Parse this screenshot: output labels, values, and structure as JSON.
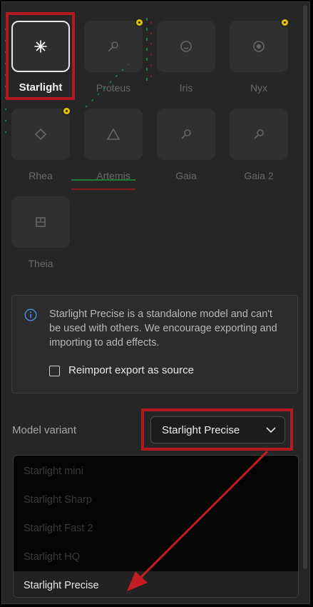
{
  "models": [
    {
      "label": "Starlight",
      "icon": "sparkle-icon",
      "selected": true,
      "badge": false
    },
    {
      "label": "Proteus",
      "icon": "wand-icon",
      "selected": false,
      "badge": true
    },
    {
      "label": "Iris",
      "icon": "face-icon",
      "selected": false,
      "badge": false
    },
    {
      "label": "Nyx",
      "icon": "moon-icon",
      "selected": false,
      "badge": true
    },
    {
      "label": "Rhea",
      "icon": "diamond-icon",
      "selected": false,
      "badge": true
    },
    {
      "label": "Artemis",
      "icon": "triangle-icon",
      "selected": false,
      "badge": false
    },
    {
      "label": "Gaia",
      "icon": "rocket-icon",
      "selected": false,
      "badge": false
    },
    {
      "label": "Gaia 2",
      "icon": "rocket-icon",
      "selected": false,
      "badge": false
    },
    {
      "label": "Theia",
      "icon": "grid-icon",
      "selected": false,
      "badge": false
    }
  ],
  "info": {
    "text": "Starlight Precise is a standalone model and can't be used with others. We encourage exporting and importing to add effects.",
    "checkbox_label": "Reimport export as source",
    "checked": false
  },
  "variant": {
    "label": "Model variant",
    "selected": "Starlight Precise",
    "options": [
      "Starlight mini",
      "Starlight Sharp",
      "Starlight Fast 2",
      "Starlight HQ",
      "Starlight Precise"
    ]
  },
  "colors": {
    "annotation": "#b3191f",
    "badge": "#e6c200",
    "panel_bg": "#262626"
  }
}
